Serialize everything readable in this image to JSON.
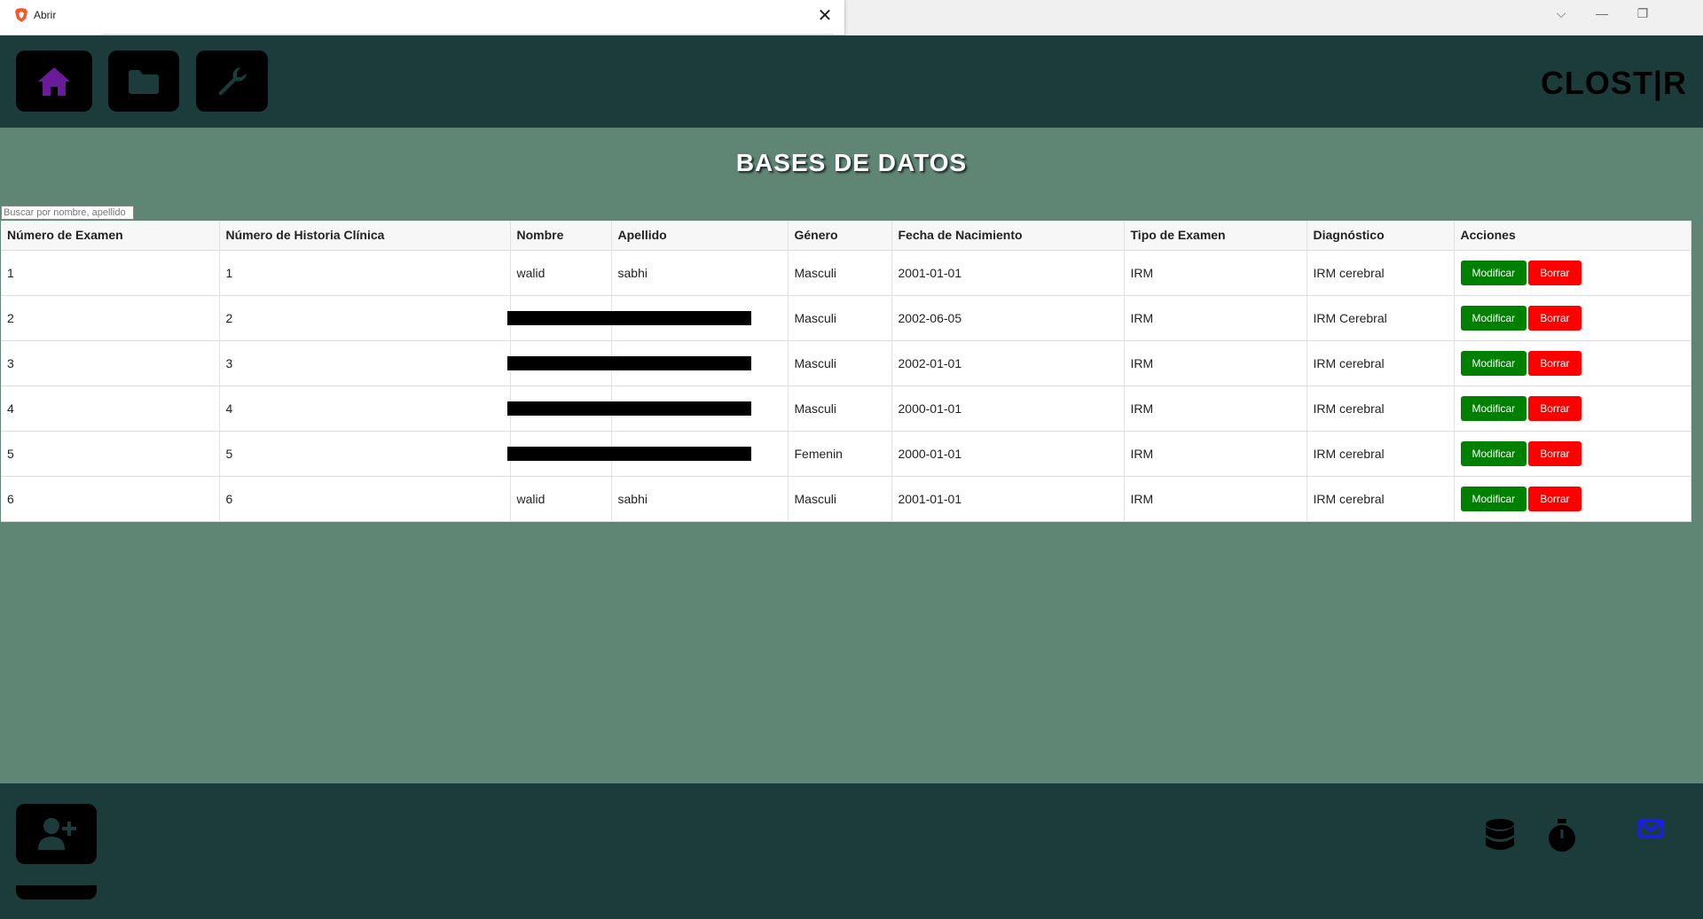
{
  "window": {
    "dialog_title": "Abrir",
    "close_glyph": "✕",
    "controls": {
      "dropdown": "⌵",
      "minimize": "—",
      "restore": "❐"
    }
  },
  "header": {
    "brand": "CLOST|R",
    "nav": [
      {
        "icon": "home-icon",
        "color": "#6a1b9a"
      },
      {
        "icon": "folder-icon",
        "color": "#1c3c3c"
      },
      {
        "icon": "wrench-icon",
        "color": "#1c3c3c"
      }
    ]
  },
  "main": {
    "title": "BASES DE DATOS",
    "search_placeholder": "Buscar por nombre, apellido",
    "columns": [
      "Número de Examen",
      "Número de Historia Clínica",
      "Nombre",
      "Apellido",
      "Género",
      "Fecha de Nacimiento",
      "Tipo de Examen",
      "Diagnóstico",
      "Acciones"
    ],
    "rows": [
      {
        "examen": "1",
        "historia": "1",
        "nombre": "walid",
        "apellido": "sabhi",
        "genero": "Masculi",
        "fecha": "2001-01-01",
        "tipo": "IRM",
        "diagnostico": "IRM cerebral",
        "redacted": false
      },
      {
        "examen": "2",
        "historia": "2",
        "nombre": "",
        "apellido": "",
        "genero": "Masculi",
        "fecha": "2002-06-05",
        "tipo": "IRM",
        "diagnostico": "IRM Cerebral",
        "redacted": true
      },
      {
        "examen": "3",
        "historia": "3",
        "nombre": "",
        "apellido": "",
        "genero": "Masculi",
        "fecha": "2002-01-01",
        "tipo": "IRM",
        "diagnostico": "IRM cerebral",
        "redacted": true
      },
      {
        "examen": "4",
        "historia": "4",
        "nombre": "",
        "apellido": "",
        "genero": "Masculi",
        "fecha": "2000-01-01",
        "tipo": "IRM",
        "diagnostico": "IRM cerebral",
        "redacted": true
      },
      {
        "examen": "5",
        "historia": "5",
        "nombre": "",
        "apellido": "",
        "genero": "Femenin",
        "fecha": "2000-01-01",
        "tipo": "IRM",
        "diagnostico": "IRM cerebral",
        "redacted": true
      },
      {
        "examen": "6",
        "historia": "6",
        "nombre": "walid",
        "apellido": "sabhi",
        "genero": "Masculi",
        "fecha": "2001-01-01",
        "tipo": "IRM",
        "diagnostico": "IRM cerebral",
        "redacted": false
      }
    ],
    "actions": {
      "modify": "Modificar",
      "delete": "Borrar"
    },
    "colors": {
      "modify": "#008000",
      "delete": "#ff0000"
    }
  },
  "footer": {
    "add_user_icon": "add-user-icon",
    "icons": [
      "database-icon",
      "stopwatch-icon",
      "mail-icon"
    ],
    "mail_color": "#1a1aff"
  }
}
